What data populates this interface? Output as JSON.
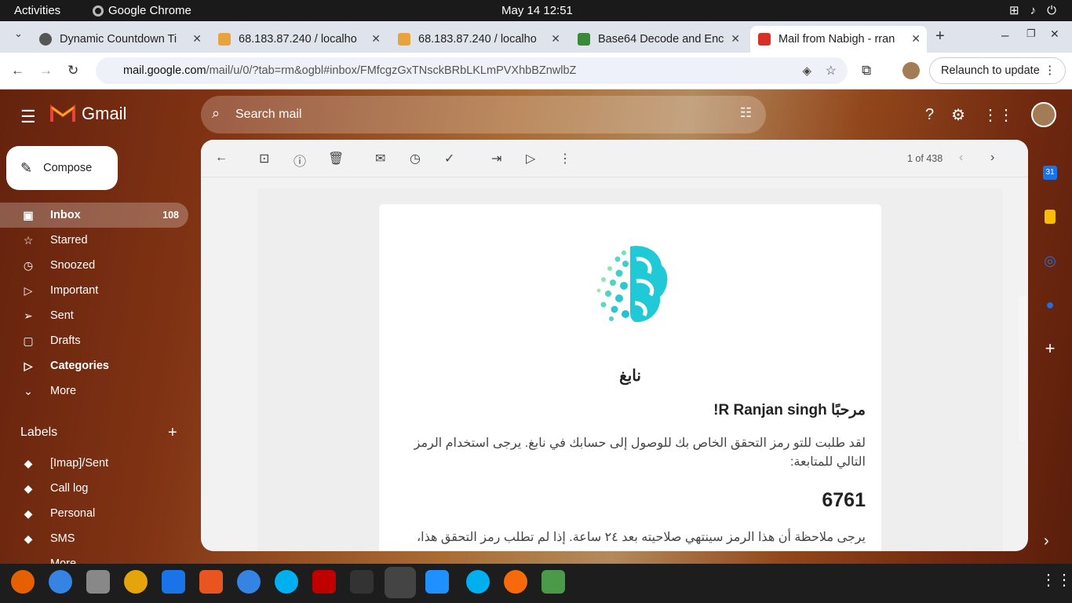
{
  "topbar": {
    "activities": "Activities",
    "app": "Google Chrome",
    "clock": "May 14  12:51"
  },
  "tabs": [
    {
      "title": "Dynamic Countdown Ti",
      "color": "#444"
    },
    {
      "title": "68.183.87.240 / localho",
      "color": "#e8a33d"
    },
    {
      "title": "68.183.87.240 / localho",
      "color": "#e8a33d"
    },
    {
      "title": "Base64 Decode and Enc",
      "color": "#3a8a3a"
    },
    {
      "title": "Mail from Nabigh - rran",
      "color": "#d93025"
    }
  ],
  "address": {
    "domain": "mail.google.com",
    "path": "/mail/u/0/?tab=rm&ogbl#inbox/FMfcgzGxTNsckBRbLKLmPVXhbBZnwlbZ"
  },
  "relaunch": "Relaunch to update",
  "gmail": {
    "brand": "Gmail",
    "search_placeholder": "Search mail",
    "compose": "Compose",
    "nav": [
      {
        "label": "Inbox",
        "count": "108",
        "icon": "inbox-icon",
        "glyph": "▣"
      },
      {
        "label": "Starred",
        "count": "",
        "icon": "star-icon",
        "glyph": "☆"
      },
      {
        "label": "Snoozed",
        "count": "",
        "icon": "clock-icon",
        "glyph": "◷"
      },
      {
        "label": "Important",
        "count": "",
        "icon": "important-icon",
        "glyph": "▷"
      },
      {
        "label": "Sent",
        "count": "",
        "icon": "send-icon",
        "glyph": "➢"
      },
      {
        "label": "Drafts",
        "count": "",
        "icon": "draft-icon",
        "glyph": "▢"
      },
      {
        "label": "Categories",
        "count": "",
        "icon": "label-icon",
        "glyph": "▷"
      },
      {
        "label": "More",
        "count": "",
        "icon": "chevron-down-icon",
        "glyph": "⌄"
      }
    ],
    "labels_heading": "Labels",
    "labels": [
      "[Imap]/Sent",
      "Call log",
      "Personal",
      "SMS",
      "More"
    ],
    "pager": "1 of 438"
  },
  "email": {
    "brand": "نابغ",
    "greeting": "مرحبًا R Ranjan singh!",
    "paragraph": "لقد طلبت للتو رمز التحقق الخاص بك للوصول إلى حسابك في نابغ. يرجى استخدام الرمز التالي للمتابعة:",
    "code": "6761",
    "paragraph2": "يرجى ملاحظة أن هذا الرمز سينتهي صلاحيته بعد ٢٤ ساعة. إذا لم تطلب رمز التحقق هذا،"
  },
  "colors": {
    "accent": "#d93025",
    "logo_teal": "#1fc9d6"
  }
}
